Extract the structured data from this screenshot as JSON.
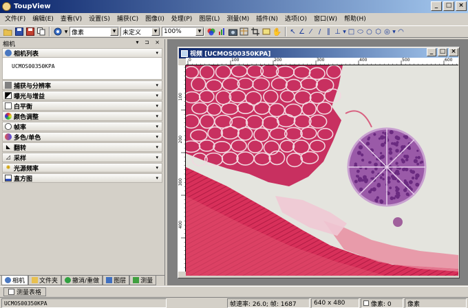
{
  "window": {
    "title": "ToupView",
    "minimize": "_",
    "maximize": "□",
    "close": "×"
  },
  "menu": [
    "文件(F)",
    "编辑(E)",
    "查看(V)",
    "设置(S)",
    "捕获(C)",
    "图像(I)",
    "处理(P)",
    "图层(L)",
    "测量(M)",
    "插件(N)",
    "选项(O)",
    "窗口(W)",
    "帮助(H)"
  ],
  "toolbar": {
    "unit_select": "像素",
    "calibration_select": "未定义",
    "zoom_select": "100%"
  },
  "panel": {
    "title": "相机",
    "controls": "▾ ⊐ ×",
    "camera_list_title": "相机列表",
    "camera_item": "UCMOS00350KPA",
    "sections": [
      "捕获与分辨率",
      "曝光与增益",
      "白平衡",
      "颜色调整",
      "帧率",
      "多色/单色",
      "翻转",
      "采样",
      "光源频率",
      "直方图"
    ]
  },
  "bottom_tabs": [
    "相机",
    "文件夹",
    "撤消/重做",
    "图层",
    "测量"
  ],
  "child_window": {
    "title": "视频 [UCMOS00350KPA]",
    "ruler_h": [
      "0",
      "100",
      "200",
      "300",
      "400",
      "500",
      "600"
    ],
    "ruler_v": [
      "100",
      "200",
      "300",
      "400"
    ]
  },
  "measure_tab": "测量表格",
  "status": {
    "camera": "UCMOS00350KPA",
    "frame_rate": "帧速率: 26.0; 帧: 1687",
    "resolution": "640 x 480",
    "pixels": "像素: 0",
    "unit": "像素"
  }
}
